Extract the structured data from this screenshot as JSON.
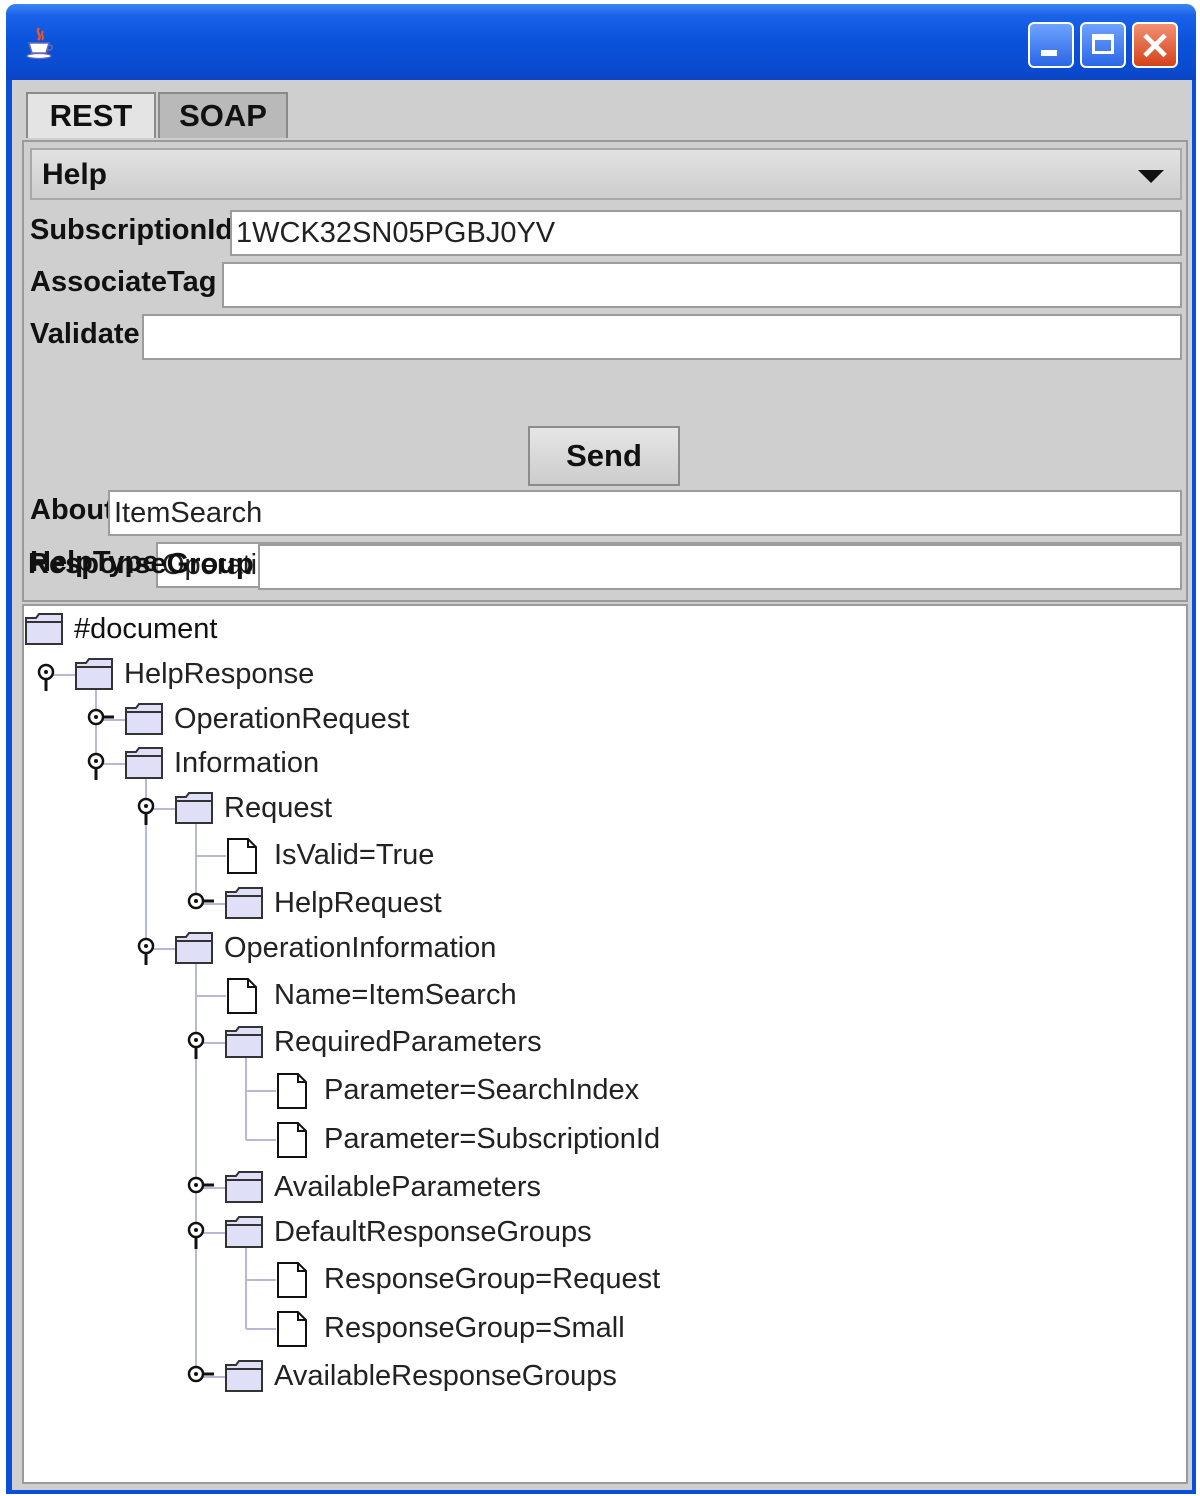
{
  "window": {
    "tabs": [
      {
        "label": "REST",
        "selected": true
      },
      {
        "label": "SOAP",
        "selected": false
      }
    ]
  },
  "operation_select": {
    "value": "Help"
  },
  "params": [
    {
      "label": "SubscriptionId",
      "value": "1WCK32SN05PGBJ0YV"
    },
    {
      "label": "AssociateTag",
      "value": ""
    },
    {
      "label": "Validate",
      "value": ""
    }
  ],
  "send_label": "Send",
  "params2": [
    {
      "label": "About",
      "value": "ItemSearch"
    },
    {
      "label": "HelpType",
      "value": "Operation"
    },
    {
      "label": "ResponseGroup",
      "value": ""
    }
  ],
  "tree": {
    "nodes": [
      {
        "label": "#document",
        "kind": "folder",
        "depth": 0,
        "state": "none"
      },
      {
        "label": "HelpResponse",
        "kind": "folder",
        "depth": 1,
        "state": "expanded"
      },
      {
        "label": "OperationRequest",
        "kind": "folder",
        "depth": 2,
        "state": "collapsed"
      },
      {
        "label": "Information",
        "kind": "folder",
        "depth": 2,
        "state": "expanded"
      },
      {
        "label": "Request",
        "kind": "folder",
        "depth": 3,
        "state": "expanded"
      },
      {
        "label": "IsValid=True",
        "kind": "leaf",
        "depth": 4,
        "state": "none"
      },
      {
        "label": "HelpRequest",
        "kind": "folder",
        "depth": 4,
        "state": "collapsed"
      },
      {
        "label": "OperationInformation",
        "kind": "folder",
        "depth": 3,
        "state": "expanded"
      },
      {
        "label": "Name=ItemSearch",
        "kind": "leaf",
        "depth": 4,
        "state": "none"
      },
      {
        "label": "RequiredParameters",
        "kind": "folder",
        "depth": 4,
        "state": "expanded"
      },
      {
        "label": "Parameter=SearchIndex",
        "kind": "leaf",
        "depth": 5,
        "state": "none"
      },
      {
        "label": "Parameter=SubscriptionId",
        "kind": "leaf",
        "depth": 5,
        "state": "none"
      },
      {
        "label": "AvailableParameters",
        "kind": "folder",
        "depth": 4,
        "state": "collapsed"
      },
      {
        "label": "DefaultResponseGroups",
        "kind": "folder",
        "depth": 4,
        "state": "expanded"
      },
      {
        "label": "ResponseGroup=Request",
        "kind": "leaf",
        "depth": 5,
        "state": "none"
      },
      {
        "label": "ResponseGroup=Small",
        "kind": "leaf",
        "depth": 5,
        "state": "none"
      },
      {
        "label": "AvailableResponseGroups",
        "kind": "folder",
        "depth": 4,
        "state": "collapsed"
      }
    ]
  },
  "colors": {
    "titlebar": "#0a52da",
    "client_bg": "#cfcfcf",
    "folder_fill": "#dfe0f7",
    "folder_stroke": "#333333",
    "tree_line": "#b8b8d8"
  },
  "icons": {
    "app": "java-cup-icon",
    "minimize": "minimize-icon",
    "maximize": "maximize-icon",
    "close": "close-icon",
    "folder": "folder-icon",
    "leaf": "document-icon",
    "expanded": "expanded-handle-icon",
    "collapsed": "collapsed-handle-icon"
  }
}
